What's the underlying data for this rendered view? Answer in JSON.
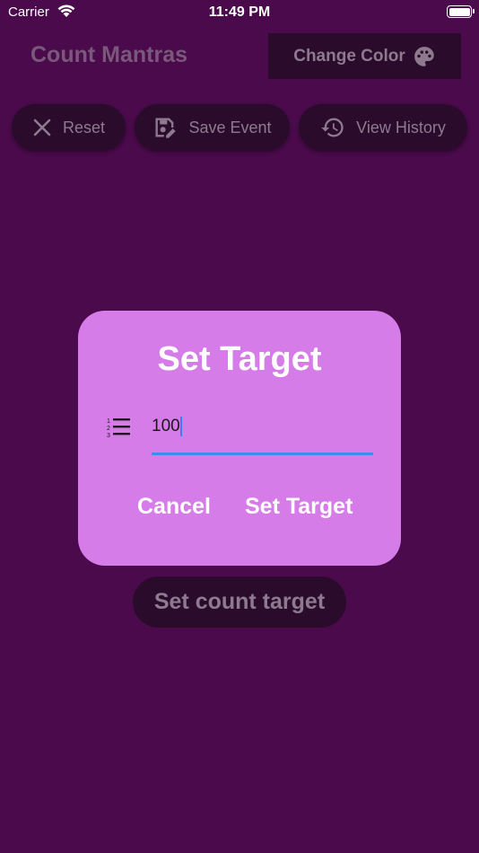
{
  "status_bar": {
    "carrier": "Carrier",
    "time": "11:49 PM"
  },
  "app_bar": {
    "title": "Count Mantras",
    "change_color_label": "Change Color"
  },
  "toolbar": {
    "reset_label": "Reset",
    "save_event_label": "Save Event",
    "view_history_label": "View History"
  },
  "dialog": {
    "title": "Set Target",
    "input_value": "100",
    "cancel_label": "Cancel",
    "confirm_label": "Set Target"
  },
  "main": {
    "set_count_target_label": "Set count target"
  },
  "colors": {
    "background": "#4a0a4b",
    "dialog": "#d57ce8",
    "input_underline": "#3a8df2",
    "button_dim": "#2b0b2c"
  }
}
